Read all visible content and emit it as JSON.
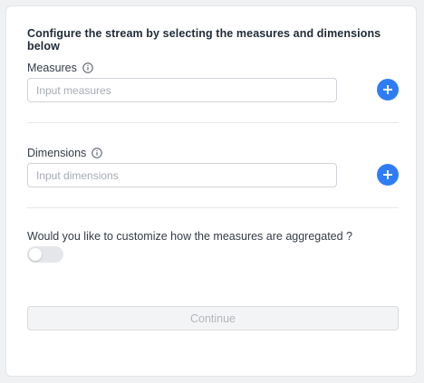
{
  "heading": "Configure the stream by selecting the measures and dimensions below",
  "measures": {
    "label": "Measures",
    "placeholder": "Input measures",
    "value": ""
  },
  "dimensions": {
    "label": "Dimensions",
    "placeholder": "Input dimensions",
    "value": ""
  },
  "aggregation": {
    "question": "Would you like to customize how the measures are aggregated ?",
    "enabled": false
  },
  "continue_label": "Continue",
  "colors": {
    "accent": "#2f7df6",
    "toggle_off": "#e4e6e9",
    "button_disabled_bg": "#f3f4f5"
  },
  "icons": {
    "info": "info-icon",
    "add": "plus-circle-icon"
  }
}
